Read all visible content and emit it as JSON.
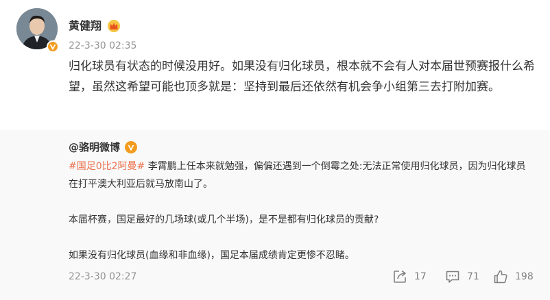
{
  "post": {
    "author": "黄健翔",
    "time": "22-3-30 02:35",
    "text": "归化球员有状态的时候没用好。如果没有归化球员，根本就不会有人对本届世预赛报什么希望，虽然这希望可能也顶多就是：坚持到最后还依然有机会争小组第三去打附加赛。"
  },
  "repost": {
    "author": "@骆明微博",
    "topic": "#国足0比2阿曼#",
    "paragraph1": " 李霄鹏上任本来就勉强，偏偏还遇到一个倒霉之处:无法正常使用归化球员，因为归化球员在打平澳大利亚后就马放南山了。",
    "paragraph2": "本届杯赛，国足最好的几场球(或几个半场)，是不是都有归化球员的贡献?",
    "paragraph3": "如果没有归化球员(血缘和非血缘)，国足本届成绩肯定更惨不忍睹。",
    "time": "22-3-30 02:27",
    "share_count": "17",
    "comment_count": "71",
    "like_count": "198"
  },
  "colors": {
    "topic": "#eb7350",
    "verified_badge": "#f29c1f",
    "muted_text": "#939393",
    "repost_bg": "#f9f9f9"
  },
  "icons": [
    "verified-badge-icon",
    "crown-icon",
    "share-icon",
    "comment-icon",
    "like-icon"
  ]
}
